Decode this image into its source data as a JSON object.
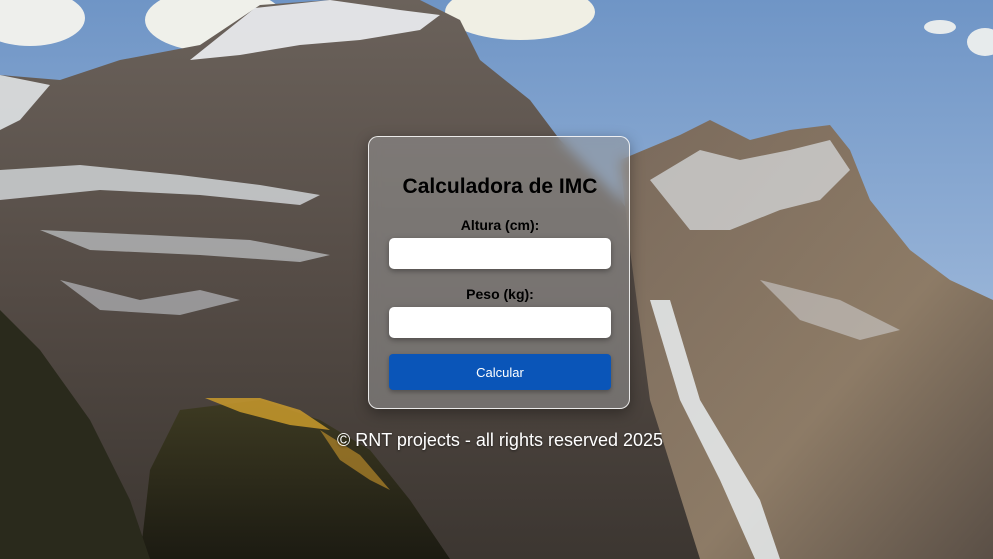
{
  "card": {
    "title": "Calculadora de IMC",
    "height_label": "Altura (cm):",
    "height_value": "",
    "weight_label": "Peso (kg):",
    "weight_value": "",
    "calculate_label": "Calcular"
  },
  "footer": {
    "text": "© RNT projects - all rights reserved 2025"
  },
  "colors": {
    "button_bg": "#0a55b8",
    "button_text": "#ffffff",
    "title_text": "#000000"
  },
  "background": {
    "image": "mountain-landscape"
  }
}
